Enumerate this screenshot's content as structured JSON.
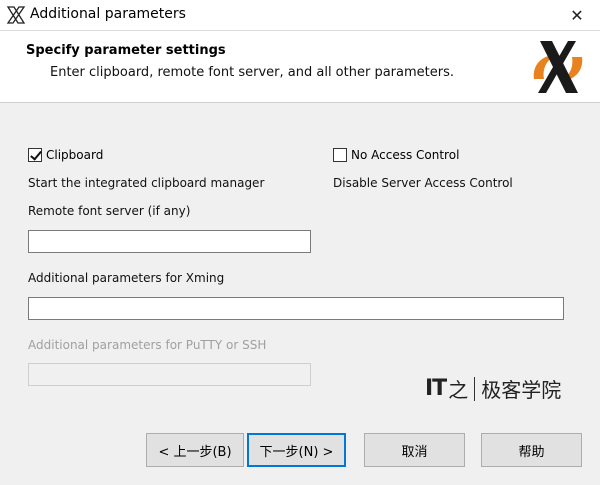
{
  "window": {
    "title": "Additional parameters",
    "close_glyph": "✕",
    "icon": "xming-x-icon"
  },
  "header": {
    "title": "Specify parameter settings",
    "subtitle": "Enter clipboard, remote font server, and all other parameters.",
    "logo": "xming-logo"
  },
  "options": {
    "clipboard": {
      "label": "Clipboard",
      "checked": true,
      "description": "Start the integrated clipboard manager"
    },
    "no_access_control": {
      "label": "No Access Control",
      "checked": false,
      "description": "Disable Server Access Control"
    }
  },
  "fields": {
    "font_server": {
      "label": "Remote font server (if any)",
      "value": ""
    },
    "xming_params": {
      "label": "Additional parameters for Xming",
      "value": ""
    },
    "putty_params": {
      "label": "Additional parameters for PuTTY or SSH",
      "value": "",
      "disabled": true
    }
  },
  "watermark": {
    "mark": "IT",
    "mark_char": "之",
    "text": "极客学院"
  },
  "buttons": {
    "back": "< 上一步(B)",
    "next": "下一步(N) >",
    "cancel": "取消",
    "help": "帮助"
  }
}
